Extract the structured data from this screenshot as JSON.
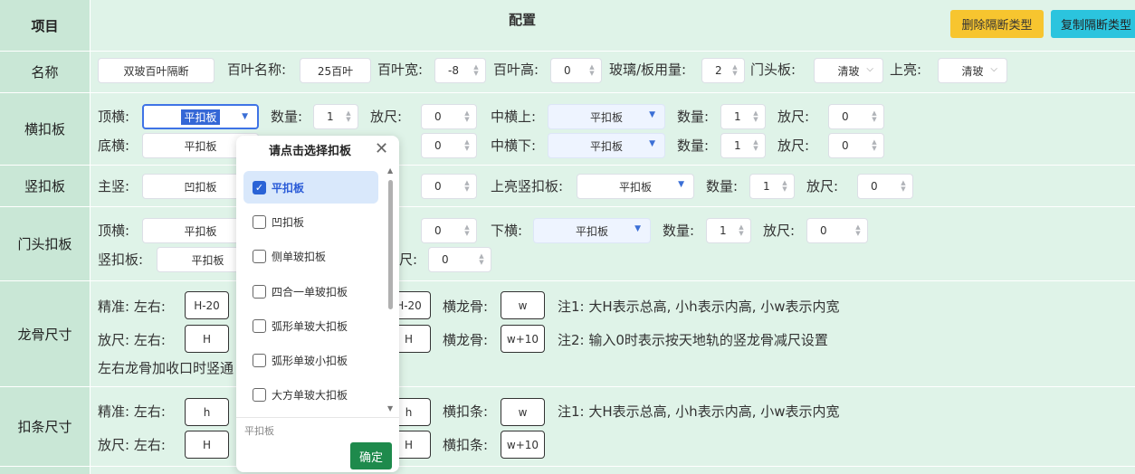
{
  "header": {
    "col1": "项目",
    "col2": "配置",
    "delete_btn": "删除隔断类型",
    "copy_btn": "复制隔断类型"
  },
  "name_row": {
    "label": "名称",
    "name_value": "双玻百叶隔断",
    "louver_name_label": "百叶名称:",
    "louver_name_value": "25百叶",
    "louver_width_label": "百叶宽:",
    "louver_width_value": "-8",
    "louver_height_label": "百叶高:",
    "louver_height_value": "0",
    "glass_label": "玻璃/板用量:",
    "glass_value": "2",
    "door_head_label": "门头板:",
    "door_head_value": "清玻",
    "top_light_label": "上亮:",
    "top_light_value": "清玻"
  },
  "h_buckle": {
    "label": "横扣板",
    "top_label": "顶横:",
    "top_value": "平扣板",
    "qty_label": "数量:",
    "qty_value": "1",
    "allow_label": "放尺:",
    "allow_value": "0",
    "mid_top_label": "中横上:",
    "mid_top_value": "平扣板",
    "qty2_label": "数量:",
    "qty2_value": "1",
    "allow2_label": "放尺:",
    "allow2_value": "0",
    "bottom_label": "底横:",
    "bottom_value": "平扣板",
    "allow3_value": "0",
    "mid_bottom_label": "中横下:",
    "mid_bottom_value": "平扣板",
    "qty3_label": "数量:",
    "qty3_value": "1",
    "allow4_label": "放尺:",
    "allow4_value": "0"
  },
  "v_buckle": {
    "label": "竖扣板",
    "main_label": "主竖:",
    "main_value": "凹扣板",
    "allow_value": "0",
    "top_light_label": "上亮竖扣板:",
    "top_light_value": "平扣板",
    "qty_label": "数量:",
    "qty_value": "1",
    "allow2_label": "放尺:",
    "allow2_value": "0"
  },
  "door_buckle": {
    "label": "门头扣板",
    "top_label": "顶横:",
    "top_value": "平扣板",
    "allow_value": "0",
    "bottom_label": "下横:",
    "bottom_value": "平扣板",
    "qty_label": "数量:",
    "qty_value": "1",
    "allow2_label": "放尺:",
    "allow2_value": "0",
    "vert_label": "竖扣板:",
    "vert_value": "平扣板",
    "allow3_label": "尺:",
    "allow3_value": "0"
  },
  "keel": {
    "label": "龙骨尺寸",
    "precise_label": "精准: 左右:",
    "precise_lr": "H-20",
    "precise_mid": "H-20",
    "h_keel_label": "横龙骨:",
    "h_keel_value": "w",
    "note1": "注1: 大H表示总高, 小h表示内高, 小w表示内宽",
    "allow_label": "放尺: 左右:",
    "allow_lr": "H",
    "allow_mid": "H",
    "h_keel2_label": "横龙骨:",
    "h_keel2_value": "w+10",
    "note2": "注2: 输入0时表示按天地轨的竖龙骨减尺设置",
    "footer_text": "左右龙骨加收口时竖通"
  },
  "strip": {
    "label": "扣条尺寸",
    "precise_label": "精准: 左右:",
    "precise_lr": "h",
    "precise_mid": "h",
    "h_strip_label": "横扣条:",
    "h_strip_value": "w",
    "note1": "注1: 大H表示总高, 小h表示内高, 小w表示内宽",
    "allow_label": "放尺: 左右:",
    "allow_lr": "H",
    "allow_mid": "H",
    "h_strip2_label": "横扣条:",
    "h_strip2_value": "w+10"
  },
  "popup": {
    "title": "请点击选择扣板",
    "options": [
      "平扣板",
      "凹扣板",
      "侧单玻扣板",
      "四合一单玻扣板",
      "弧形单玻大扣板",
      "弧形单玻小扣板",
      "大方单玻大扣板"
    ],
    "selected": "平扣板",
    "footer_text": "平扣板",
    "ok": "确定"
  },
  "colors": {
    "label_bg": "#c9e7d6",
    "content_bg": "#dff3e8",
    "ok_btn": "#1e8a4c",
    "delete_btn": "#f7c52f",
    "copy_btn": "#2bc4de"
  }
}
